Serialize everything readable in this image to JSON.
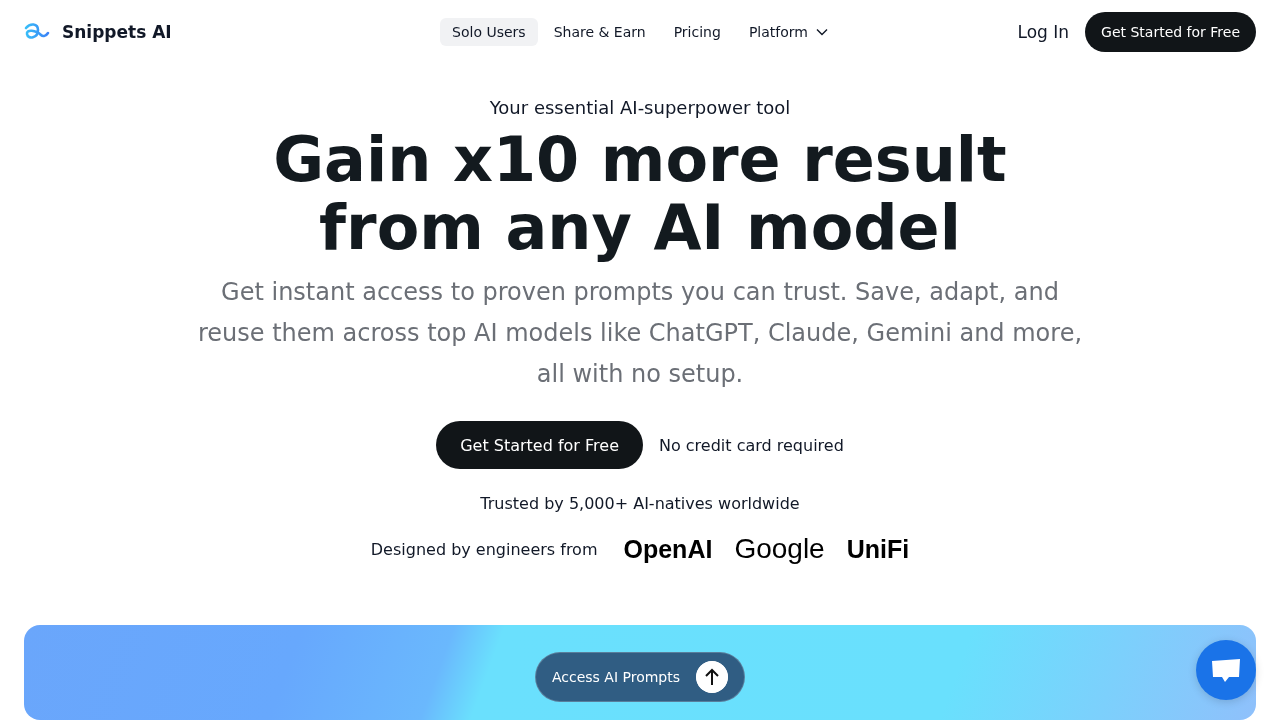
{
  "header": {
    "brand": "Snippets AI",
    "nav": [
      {
        "label": "Solo Users",
        "selected": true,
        "dropdown": false
      },
      {
        "label": "Share & Earn",
        "selected": false,
        "dropdown": false
      },
      {
        "label": "Pricing",
        "selected": false,
        "dropdown": false
      },
      {
        "label": "Platform",
        "selected": false,
        "dropdown": true
      }
    ],
    "login": "Log In",
    "cta": "Get Started for Free"
  },
  "hero": {
    "tagline": "Your essential AI-superpower tool",
    "headline": [
      "Gain x10 more result",
      "from any AI model"
    ],
    "subtitle": "Get instant access to proven prompts you can trust. Save, adapt, and reuse them across top AI models like ChatGPT, Claude, Gemini and more, all with no setup.",
    "cta": "Get Started for Free",
    "cta_note": "No credit card required",
    "trusted": "Trusted by 5,000+ AI-natives worldwide",
    "designed_by": "Designed by engineers from",
    "companies": [
      "OpenAI",
      "Google",
      "UniFi"
    ]
  },
  "banner": {
    "button": "Access AI Prompts"
  }
}
